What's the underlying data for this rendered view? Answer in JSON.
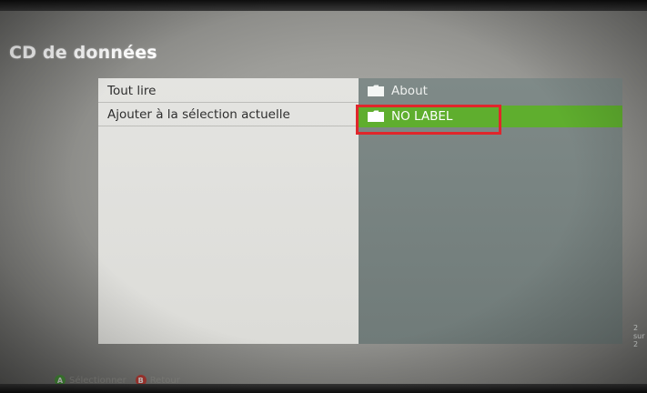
{
  "page": {
    "title": "CD de données"
  },
  "options": {
    "items": [
      {
        "label": "Tout lire"
      },
      {
        "label": "Ajouter à la sélection actuelle"
      }
    ]
  },
  "files": {
    "items": [
      {
        "label": "About",
        "icon": "folder-icon",
        "selected": false
      },
      {
        "label": "NO LABEL",
        "icon": "folder-icon",
        "selected": true
      }
    ],
    "page_indicator": "2 sur 2"
  },
  "hints": {
    "a_glyph": "A",
    "a_label": "Sélectionner",
    "b_glyph": "B",
    "b_label": "Retour"
  },
  "colors": {
    "selected_row": "#5fae2e",
    "highlight_box": "#e0262b",
    "files_pane": "#7f8a88",
    "options_pane": "#e4e4e1"
  }
}
